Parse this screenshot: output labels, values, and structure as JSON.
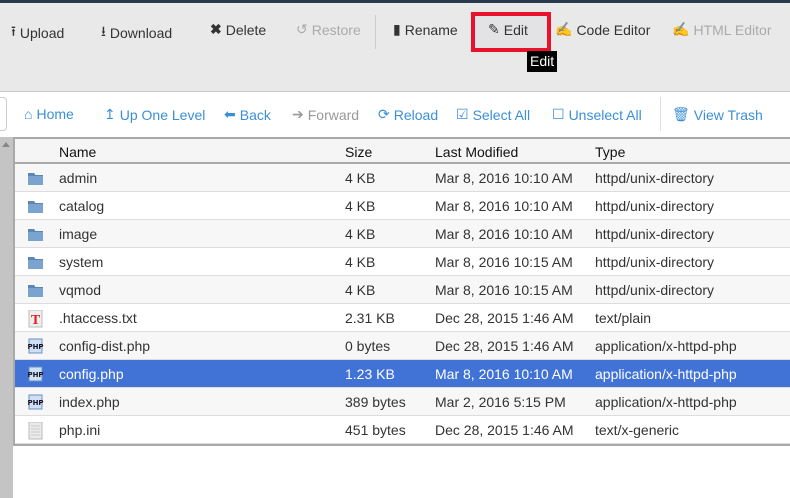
{
  "toolbar": {
    "upload": "Upload",
    "download": "Download",
    "delete": "Delete",
    "restore": "Restore",
    "rename": "Rename",
    "edit": "Edit",
    "code_editor": "Code Editor",
    "html_editor": "HTML Editor",
    "tooltip": "Edit"
  },
  "nav": {
    "home": "Home",
    "up": "Up One Level",
    "back": "Back",
    "forward": "Forward",
    "reload": "Reload",
    "select_all": "Select All",
    "unselect_all": "Unselect All",
    "trash": "View Trash"
  },
  "table": {
    "headers": {
      "name": "Name",
      "size": "Size",
      "modified": "Last Modified",
      "type": "Type"
    },
    "rows": [
      {
        "icon": "folder",
        "name": "admin",
        "size": "4 KB",
        "modified": "Mar 8, 2016 10:10 AM",
        "type": "httpd/unix-directory"
      },
      {
        "icon": "folder",
        "name": "catalog",
        "size": "4 KB",
        "modified": "Mar 8, 2016 10:10 AM",
        "type": "httpd/unix-directory"
      },
      {
        "icon": "folder",
        "name": "image",
        "size": "4 KB",
        "modified": "Mar 8, 2016 10:10 AM",
        "type": "httpd/unix-directory"
      },
      {
        "icon": "folder",
        "name": "system",
        "size": "4 KB",
        "modified": "Mar 8, 2016 10:15 AM",
        "type": "httpd/unix-directory"
      },
      {
        "icon": "folder",
        "name": "vqmod",
        "size": "4 KB",
        "modified": "Mar 8, 2016 10:15 AM",
        "type": "httpd/unix-directory"
      },
      {
        "icon": "text",
        "name": ".htaccess.txt",
        "size": "2.31 KB",
        "modified": "Dec 28, 2015 1:46 AM",
        "type": "text/plain"
      },
      {
        "icon": "php",
        "name": "config-dist.php",
        "size": "0 bytes",
        "modified": "Dec 28, 2015 1:46 AM",
        "type": "application/x-httpd-php"
      },
      {
        "icon": "php",
        "name": "config.php",
        "size": "1.23 KB",
        "modified": "Mar 8, 2016 10:10 AM",
        "type": "application/x-httpd-php",
        "selected": true
      },
      {
        "icon": "php",
        "name": "index.php",
        "size": "389 bytes",
        "modified": "Mar 2, 2016 5:15 PM",
        "type": "application/x-httpd-php"
      },
      {
        "icon": "generic",
        "name": "php.ini",
        "size": "451 bytes",
        "modified": "Dec 28, 2015 1:46 AM",
        "type": "text/x-generic"
      }
    ]
  }
}
